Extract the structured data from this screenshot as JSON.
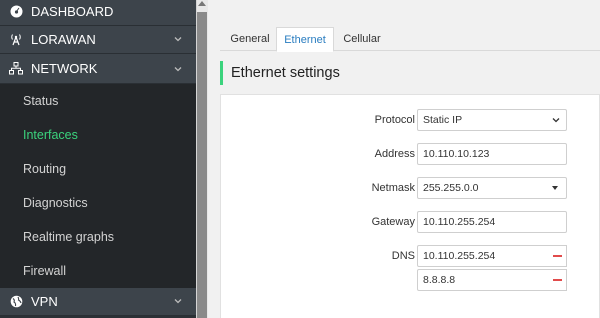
{
  "sidebar": {
    "dashboard": "DASHBOARD",
    "lorawan": "LORAWAN",
    "network": "NETWORK",
    "network_items": [
      "Status",
      "Interfaces",
      "Routing",
      "Diagnostics",
      "Realtime graphs",
      "Firewall"
    ],
    "active_item": "Interfaces",
    "vpn": "VPN"
  },
  "tabs": [
    "General",
    "Ethernet",
    "Cellular"
  ],
  "active_tab": "Ethernet",
  "section_title": "Ethernet settings",
  "form": {
    "protocol_label": "Protocol",
    "protocol_value": "Static IP",
    "address_label": "Address",
    "address_value": "10.110.10.123",
    "netmask_label": "Netmask",
    "netmask_value": "255.255.0.0",
    "gateway_label": "Gateway",
    "gateway_value": "10.110.255.254",
    "dns_label": "DNS",
    "dns_values": [
      "10.110.255.254",
      "8.8.8.8"
    ]
  },
  "colors": {
    "sidebar_bg": "#2c3136",
    "accent_green": "#3bd37d",
    "tab_active_blue": "#2a7dc0",
    "remove_red": "#e14b4b"
  }
}
